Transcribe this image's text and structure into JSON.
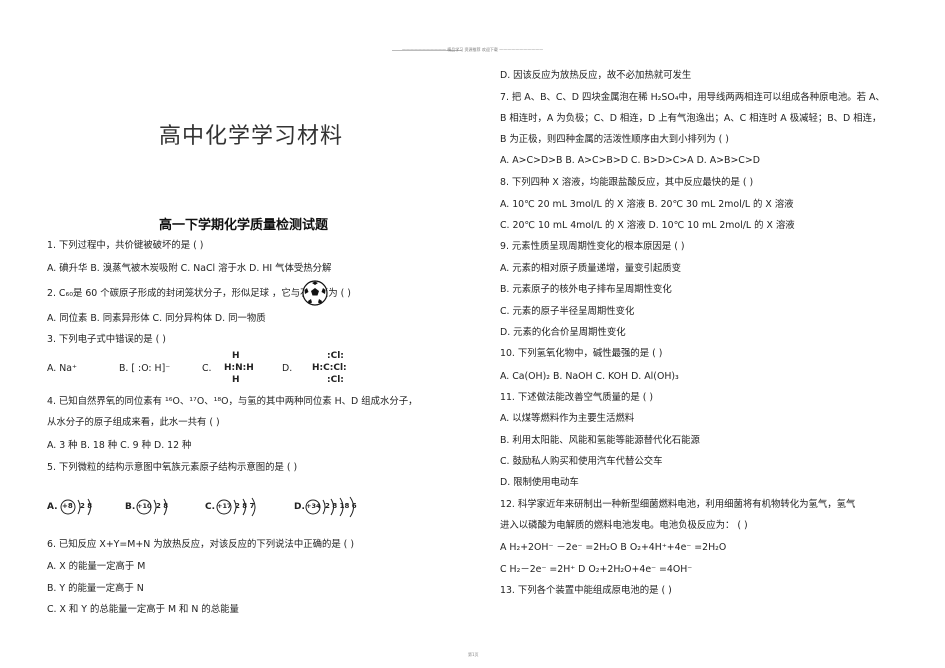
{
  "header": {
    "text": "——————————— 精品学习 资源推荐 欢迎下载 ———————————"
  },
  "footer": {
    "text": "第1页"
  },
  "doc": {
    "main_title": "高中化学学习材料",
    "subtitle": "高一下学期化学质量检测试题"
  },
  "left": {
    "q1": "1. 下列过程中，共价键被破坏的是          (     )",
    "q1_opts": "A. 碘升华   B. 溴蒸气被木炭吸附     C. NaCl 溶于水     D. HI 气体受热分解",
    "q2": "2. C₆₀是 60 个碳原子形成的封闭笼状分子，形似足球          ，它与石墨互为  (   )",
    "q2_opts": "A. 同位素       B. 同素异形体      C. 同分异构体      D. 同一物质",
    "q3": "3. 下列电子式中错误的是          (          )",
    "q3_a": "A.  Na⁺",
    "q3_b": "B.  [ :O: H]⁻",
    "q3_c_label": "C.",
    "q3_c": "H:N:H",
    "q3_c_top": "H",
    "q3_c_bottom": "H",
    "q3_d_label": "D.",
    "q3_d": "H:C:Cl:",
    "q3_d_top": ":Cl:",
    "q3_d_bottom": ":Cl:",
    "q4": "4. 已知自然界氧的同位素有 ¹⁶O、¹⁷O、¹⁸O，与氢的其中两种同位素 H、D 组成水分子，",
    "q4_cont": "从水分子的原子组成来看，此水一共有      (     )",
    "q4_opts": "A. 3 种           B. 18 种           C. 9 种        D. 12 种",
    "q5": "5. 下列微粒的结构示意图中氧族元素原子结构示意图的是 (    )",
    "q5_a": "A.",
    "q5_a_core": "+8",
    "q5_a_shells": "2 8",
    "q5_b": "B.",
    "q5_b_core": "+10",
    "q5_b_shells": "2 8",
    "q5_c": "C.",
    "q5_c_core": "+17",
    "q5_c_shells": "2 8 7",
    "q5_d": "D.",
    "q5_d_core": "+34",
    "q5_d_shells": "2 8 18 6",
    "q6": "6. 已知反应 X+Y=M+N 为放热反应，对该反应的下列说法中正确的是 (     )",
    "q6_a": "A. X 的能量一定高于 M",
    "q6_b": "B. Y 的能量一定高于 N",
    "q6_c": "C. X 和 Y 的总能量一定高于 M 和 N 的总能量"
  },
  "right": {
    "q6_d": "D. 因该反应为放热反应，故不必加热就可发生",
    "q7": "7. 把 A、B、C、D 四块金属泡在稀 H₂SO₄中，用导线两两相连可以组成各种原电池。若 A、",
    "q7_cont1": "B 相连时，A 为负极；C、D 相连，D 上有气泡逸出；A、C 相连时 A 极减轻；B、D 相连，",
    "q7_cont2": "B 为正极，则四种金属的活泼性顺序由大到小排列为  (    )",
    "q7_opts": "A. A>C>D>B      B. A>C>B>D    C. B>D>C>A        D. A>B>C>D",
    "q8": "8. 下列四种 X 溶液，均能跟盐酸反应，其中反应最快的是 (    )",
    "q8_ab": "A. 10℃  20 mL 3mol/L 的 X 溶液          B. 20℃  30 mL 2mol/L 的 X 溶液",
    "q8_cd": "C. 20℃  10 mL 4mol/L 的 X 溶液          D. 10℃  10 mL 2mol/L 的 X 溶液",
    "q9": "9. 元素性质呈现周期性变化的根本原因是 (    )",
    "q9_a": "A. 元素的相对原子质量递增，量变引起质变",
    "q9_b": "B. 元素原子的核外电子排布呈周期性变化",
    "q9_c": "C. 元素的原子半径呈周期性变化",
    "q9_d": "D. 元素的化合价呈周期性变化",
    "q10": "10. 下列氢氧化物中，碱性最强的是   (     )",
    "q10_opts": "A. Ca(OH)₂      B. NaOH      C. KOH      D. Al(OH)₃",
    "q11": "11. 下述做法能改善空气质量的是 (    )",
    "q11_a": "A. 以煤等燃料作为主要生活燃料",
    "q11_b": "B. 利用太阳能、风能和氢能等能源替代化石能源",
    "q11_c": "C. 鼓励私人购买和使用汽车代替公交车",
    "q11_d": "D. 限制使用电动车",
    "q12": "12. 科学家近年来研制出一种新型细菌燃料电池，利用细菌将有机物转化为氢气，氢气",
    "q12_cont": "进入以磷酸为电解质的燃料电池发电。电池负极反应为：  (     )",
    "q12_ab": "A   H₂+2OH⁻ －2e⁻ =2H₂O        B   O₂+4H⁺+4e⁻ =2H₂O",
    "q12_cd": "C   H₂－2e⁻ =2H⁺                 D   O₂+2H₂O+4e⁻ =4OH⁻",
    "q13": "13. 下列各个装置中能组成原电池的是      (     )"
  }
}
